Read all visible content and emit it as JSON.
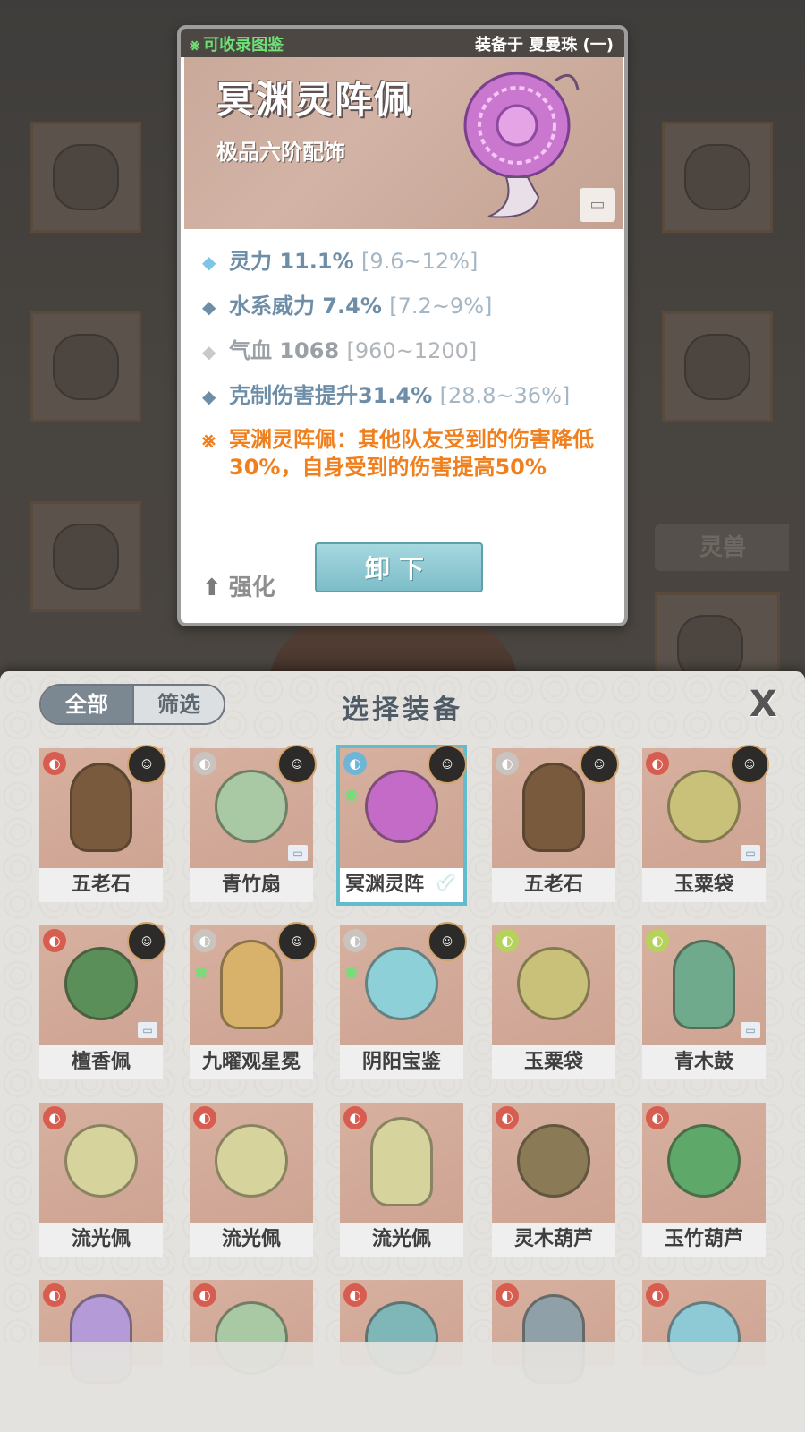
{
  "detail_card": {
    "collect_label": "可收录图鉴",
    "equipped_on": "装备于 夏曼珠 (一)",
    "item_name": "冥渊灵阵佩",
    "item_type": "极品六阶配饰",
    "stats": [
      {
        "text": "灵力 11.1%",
        "range": "[9.6~12%]",
        "style": "light"
      },
      {
        "text": "水系威力 7.4%",
        "range": "[7.2~9%]",
        "style": "dark"
      },
      {
        "text": "气血 1068",
        "range": "[960~1200]",
        "style": "grey"
      },
      {
        "text": "克制伤害提升31.4%",
        "range": "[28.8~36%]",
        "style": "dark"
      }
    ],
    "special_effect": "冥渊灵阵佩：其他队友受到的伤害降低30%，自身受到的伤害提高50%",
    "enhance_label": "强化",
    "unequip_label": "卸下"
  },
  "background": {
    "tag_label": "灵兽"
  },
  "panel": {
    "title": "选择装备",
    "tab_all": "全部",
    "tab_filter": "筛选",
    "close_label": "X"
  },
  "items": [
    {
      "name": "五老石",
      "element": "red",
      "portrait": true,
      "color": "#7a5a3c"
    },
    {
      "name": "青竹扇",
      "element": "grey",
      "portrait": true,
      "lock": true,
      "color": "#a9c9a4"
    },
    {
      "name": "冥渊灵阵",
      "element": "blue",
      "portrait": true,
      "collect": true,
      "selected": true,
      "color": "#c36bc6"
    },
    {
      "name": "五老石",
      "element": "grey",
      "portrait": true,
      "color": "#7a5a3c"
    },
    {
      "name": "玉粟袋",
      "element": "red",
      "portrait": true,
      "lock": true,
      "color": "#c9c07a"
    },
    {
      "name": "檀香佩",
      "element": "red",
      "portrait": true,
      "lock": true,
      "color": "#5b8f5a"
    },
    {
      "name": "九曜观星冕",
      "element": "grey",
      "portrait": true,
      "collect": true,
      "color": "#d8b26a"
    },
    {
      "name": "阴阳宝鉴",
      "element": "grey",
      "portrait": true,
      "collect": true,
      "color": "#8ed0d8"
    },
    {
      "name": "玉粟袋",
      "element": "green",
      "color": "#c9c07a"
    },
    {
      "name": "青木鼓",
      "element": "green",
      "lock": true,
      "color": "#6faa8c"
    },
    {
      "name": "流光佩",
      "element": "red",
      "color": "#d6d49c"
    },
    {
      "name": "流光佩",
      "element": "red",
      "color": "#d6d49c"
    },
    {
      "name": "流光佩",
      "element": "red",
      "color": "#d6d49c"
    },
    {
      "name": "灵木葫芦",
      "element": "red",
      "color": "#8a7a56"
    },
    {
      "name": "玉竹葫芦",
      "element": "red",
      "color": "#5ea86a"
    },
    {
      "name": "",
      "element": "red",
      "color": "#b49ad6"
    },
    {
      "name": "",
      "element": "red",
      "color": "#a9c9a4"
    },
    {
      "name": "",
      "element": "red",
      "color": "#7fb6b8"
    },
    {
      "name": "",
      "element": "red",
      "color": "#8fa0a8"
    },
    {
      "name": "",
      "element": "red",
      "color": "#8ec9d6"
    }
  ]
}
